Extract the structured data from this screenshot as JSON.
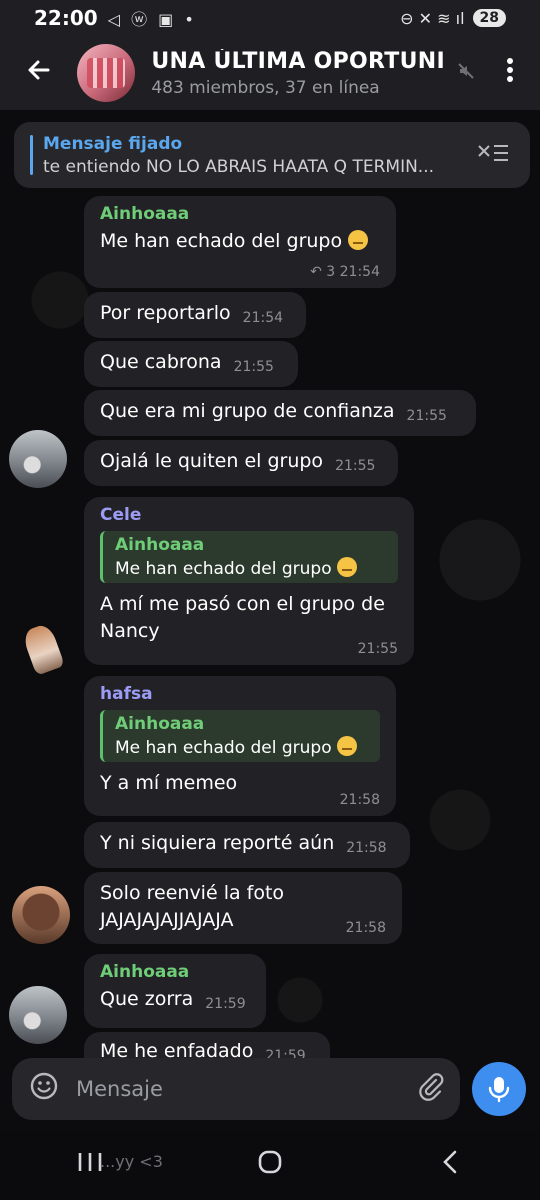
{
  "status_bar": {
    "time": "22:00",
    "left_icons": "◁ ⓦ ▣ •",
    "right_icons": "⊖ ✕ ≋ ıl",
    "battery": "28"
  },
  "header": {
    "title": "UNA ÚLTIMA OPORTUNI",
    "subtitle": "483 miembros, 37 en línea"
  },
  "pinned": {
    "title": "Mensaje fijado",
    "text": "te entiendo NO LO ABRAIS HAATA Q TERMIN..."
  },
  "messages": [
    {
      "sender": "Ainhoaaa",
      "text": "Me han echado del grupo",
      "replies": "↶ 3",
      "time": "21:54"
    },
    {
      "text": "Por reportarlo",
      "time": "21:54"
    },
    {
      "text": "Que cabrona",
      "time": "21:55"
    },
    {
      "text": "Que era mi grupo de confianza",
      "time": "21:55"
    },
    {
      "text": "Ojalá le quiten el grupo",
      "time": "21:55"
    },
    {
      "sender": "Cele",
      "reply_name": "Ainhoaaa",
      "reply_text": "Me han echado del grupo",
      "text": "A mí me pasó con el grupo de Nancy",
      "time": "21:55"
    },
    {
      "sender": "hafsa",
      "reply_name": "Ainhoaaa",
      "reply_text": "Me han echado del grupo",
      "text": "Y a mí memeo",
      "time": "21:58"
    },
    {
      "text": "Y ni siquiera reporté aún",
      "time": "21:58"
    },
    {
      "text": "Solo reenvié la foto JAJAJAJAJJAJAJA",
      "time": "21:58"
    },
    {
      "sender": "Ainhoaaa",
      "text": "Que zorra",
      "time": "21:59"
    },
    {
      "text": "Me he enfadado",
      "time": "21:59"
    }
  ],
  "input": {
    "placeholder": "Mensaje"
  },
  "nav_peek": "...yy <3"
}
